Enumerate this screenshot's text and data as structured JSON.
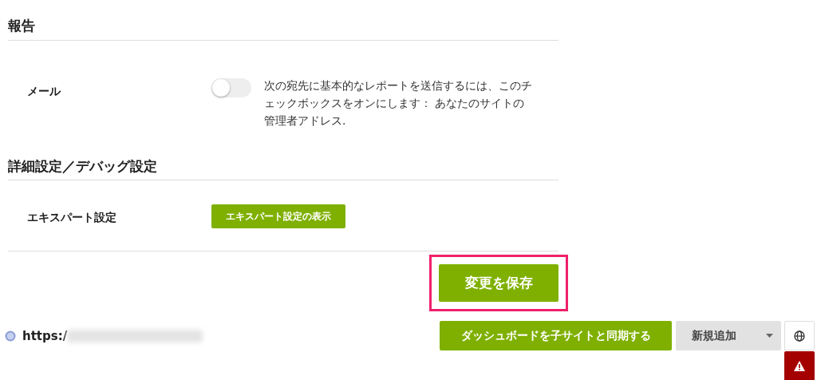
{
  "sections": [
    {
      "title": "報告",
      "rows": [
        {
          "kind": "toggle",
          "label": "メール",
          "on": false,
          "description": "次の宛先に基本的なレポートを送信するには、このチェックボックスをオンにします： あなたのサイトの管理者アドレス."
        }
      ]
    },
    {
      "title": "詳細設定／デバッグ設定",
      "rows": [
        {
          "kind": "button",
          "label": "エキスパート設定",
          "button": "エキスパート設定の表示"
        }
      ]
    }
  ],
  "save_button": {
    "label": "変更を保存",
    "highlighted": true
  },
  "footer": {
    "url": "https:/",
    "sync_button": "ダッシュボードを子サイトと同期する",
    "add_new": "新規追加"
  }
}
